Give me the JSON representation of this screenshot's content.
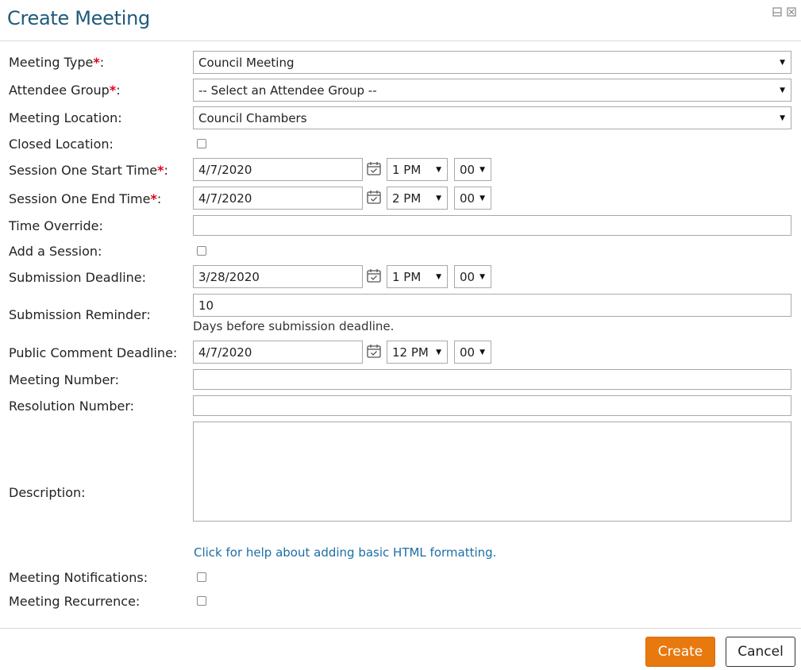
{
  "dialog": {
    "title": "Create Meeting",
    "icons": [
      "restore-icon",
      "close-icon"
    ]
  },
  "form": {
    "required_marker": "*",
    "meeting_type": {
      "label": "Meeting Type",
      "suffix": ":",
      "value": "Council Meeting"
    },
    "attendee_group": {
      "label": "Attendee Group",
      "suffix": ":",
      "value": "-- Select an Attendee Group --"
    },
    "meeting_location": {
      "label": "Meeting Location:",
      "value": "Council Chambers"
    },
    "closed_location": {
      "label": "Closed Location:",
      "checked": false
    },
    "session_start": {
      "label": "Session One Start Time",
      "suffix": ":",
      "date": "4/7/2020",
      "hour": "1 PM",
      "minute": "00"
    },
    "session_end": {
      "label": "Session One End Time",
      "suffix": ":",
      "date": "4/7/2020",
      "hour": "2 PM",
      "minute": "00"
    },
    "time_override": {
      "label": "Time Override:",
      "value": ""
    },
    "add_session": {
      "label": "Add a Session:",
      "checked": false
    },
    "submission_deadline": {
      "label": "Submission Deadline:",
      "date": "3/28/2020",
      "hour": "1 PM",
      "minute": "00"
    },
    "submission_reminder": {
      "label": "Submission Reminder:",
      "value": "10",
      "help": "Days before submission deadline."
    },
    "public_comment_deadline": {
      "label": "Public Comment Deadline:",
      "date": "4/7/2020",
      "hour": "12 PM",
      "minute": "00"
    },
    "meeting_number": {
      "label": "Meeting Number:",
      "value": ""
    },
    "resolution_number": {
      "label": "Resolution Number:",
      "value": ""
    },
    "description": {
      "label": "Description:",
      "value": ""
    },
    "html_help_link": "Click for help about adding basic HTML formatting.",
    "meeting_notifications": {
      "label": "Meeting Notifications:",
      "checked": false
    },
    "meeting_recurrence": {
      "label": "Meeting Recurrence:",
      "checked": false
    }
  },
  "footer": {
    "create_label": "Create",
    "cancel_label": "Cancel"
  },
  "colors": {
    "title": "#1f5a7a",
    "required": "#e0001b",
    "primary_button": "#e8790f",
    "link": "#1c6ea4"
  }
}
